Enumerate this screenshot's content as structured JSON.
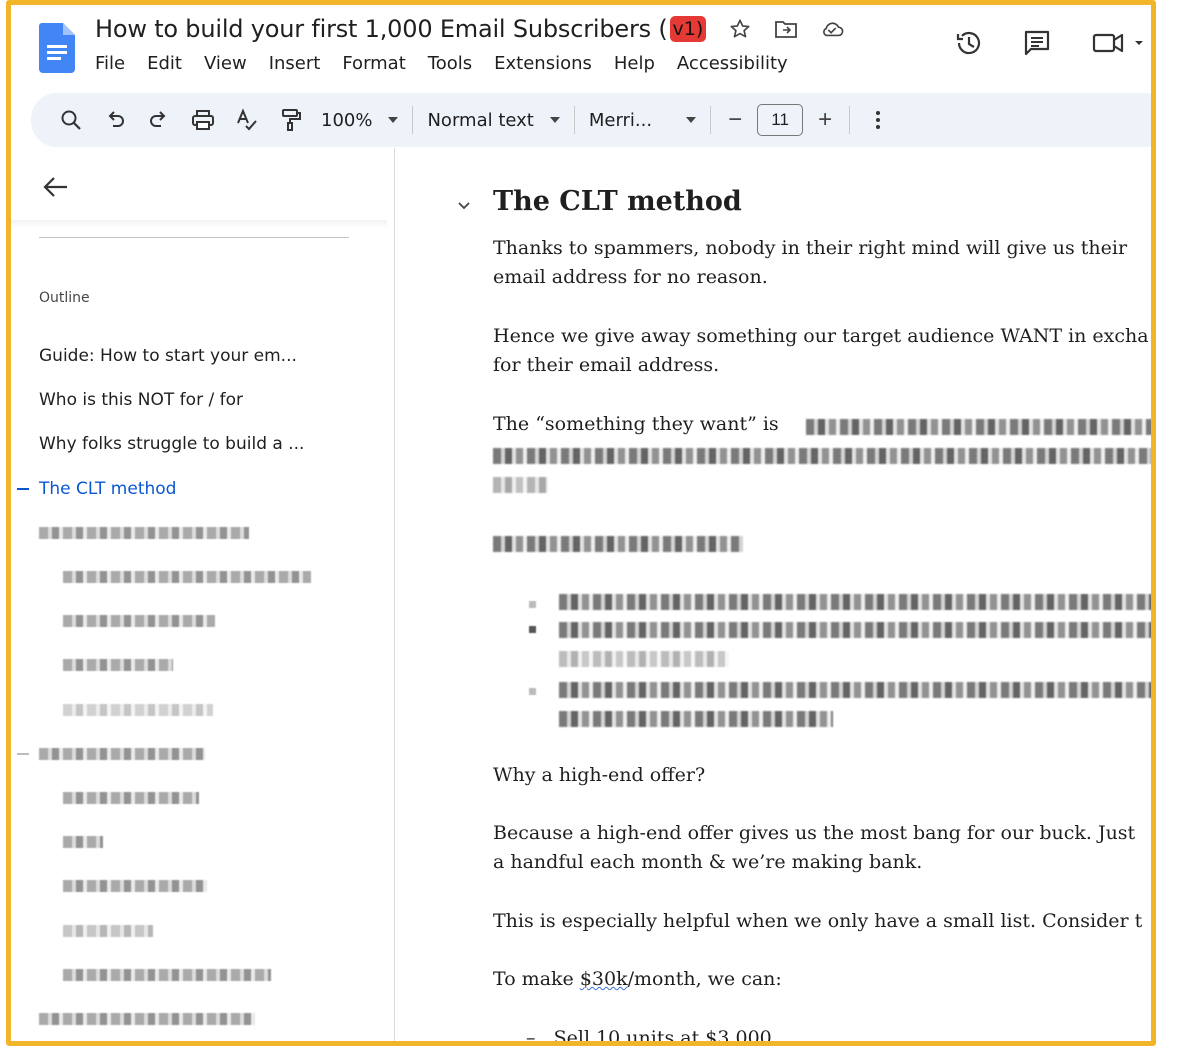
{
  "window": {
    "doc_title": "How to build your first 1,000 Email Subscribers (",
    "version_badge": "v1)",
    "title_icons": [
      "star-icon",
      "move-to-folder-icon",
      "cloud-saved-icon"
    ],
    "right_icons": [
      "version-history-icon",
      "comments-icon",
      "meet-video-icon"
    ]
  },
  "menu": [
    "File",
    "Edit",
    "View",
    "Insert",
    "Format",
    "Tools",
    "Extensions",
    "Help",
    "Accessibility"
  ],
  "toolbar": {
    "zoom": "100%",
    "style": "Normal text",
    "font": "Merri...",
    "font_size": "11",
    "minus": "−",
    "plus": "+"
  },
  "sidebar": {
    "outline_label": "Outline",
    "items": [
      "Guide: How to start your em...",
      "Who is this NOT for / for",
      "Why folks struggle to build a ...",
      "The CLT method"
    ],
    "active_item": "The CLT method"
  },
  "document": {
    "heading": "The CLT method",
    "p1_line1": "Thanks to spammers, nobody in their right mind will give us their",
    "p1_line2": "email address for no reason.",
    "p2_line1": "Hence we give away something our target audience WANT in excha",
    "p2_line2": "for their email address.",
    "p3_line1": "The “something they want” is",
    "p4": "Why a high-end offer?",
    "p5_line1": "Because a high-end offer gives us the most bang for our buck. Just",
    "p5_line2": "a handful each month & we’re making bank.",
    "p6": "This is especially helpful when we only have a small list. Consider t",
    "p7_prefix": "To make ",
    "p7_money": "$30k",
    "p7_suffix": "/month, we can:",
    "list_item1": "Sell 10 units at $3,000"
  },
  "colors": {
    "frame_border": "#f2b52a",
    "accent": "#0b57d0",
    "toolbar_bg": "#eef2f9",
    "version_badge": "#e53935"
  }
}
